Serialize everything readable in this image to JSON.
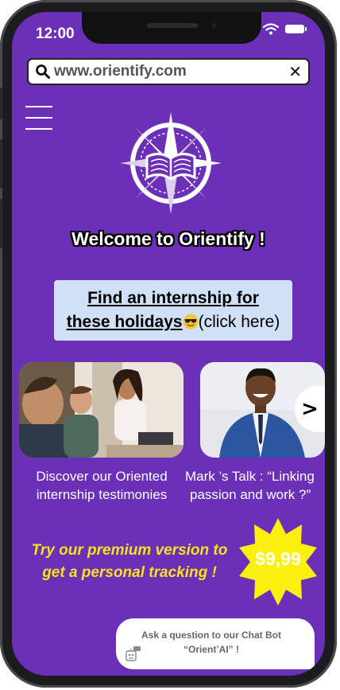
{
  "status_bar": {
    "time": "12:00"
  },
  "browser": {
    "url": "www.orientify.com",
    "close_glyph": "✕"
  },
  "welcome": "Welcome to Orientify !",
  "cta": {
    "line1": "Find an internship for",
    "line2_link": "these holidays",
    "line2_rest": "(click here)",
    "emoji": "sunglasses-emoji"
  },
  "cards": [
    {
      "caption_line1": "Discover our Oriented",
      "caption_line2": "internship testimonies"
    },
    {
      "caption_line1": "Mark ’s Talk : “Linking",
      "caption_line2": "passion and work ?”"
    }
  ],
  "carousel": {
    "next_label": ">"
  },
  "premium": {
    "line1": "Try our premium version to",
    "line2": "get a personal tracking !",
    "price": "$9,99"
  },
  "chatbot": {
    "line1": "Ask a question to our Chat Bot",
    "line2": "“Orient’AI” !"
  },
  "colors": {
    "background": "#6b2fb8",
    "cta_background": "#cfe0f7",
    "premium_text": "#f7e21c",
    "price_star": "#fbef0f"
  }
}
